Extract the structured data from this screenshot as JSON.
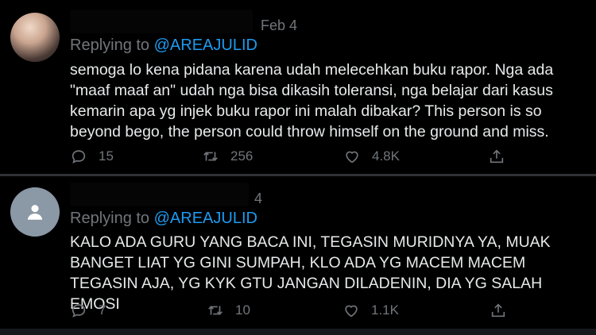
{
  "tweets": [
    {
      "date": "Feb 4",
      "replying_to_prefix": "Replying to ",
      "replying_to_handle": "@AREAJULID",
      "text": "semoga lo kena pidana karena udah melecehkan buku rapor. Nga ada \"maaf maaf an\" udah nga bisa dikasih toleransi, nga belajar dari kasus kemarin apa yg injek buku rapor ini malah dibakar? This person is so beyond bego, the person could throw himself on the ground and miss.",
      "replies": "15",
      "retweets": "256",
      "likes": "4.8K"
    },
    {
      "date": "4",
      "replying_to_prefix": "Replying to ",
      "replying_to_handle": "@AREAJULID",
      "text": "KALO ADA GURU YANG BACA INI, TEGASIN MURIDNYA YA, MUAK BANGET LIAT YG GINI SUMPAH, KLO ADA YG MACEM MACEM TEGASIN AJA, YG KYK GTU JANGAN DILADENIN, DIA YG SALAH EMOSI",
      "replies": "7",
      "retweets": "10",
      "likes": "1.1K"
    }
  ],
  "icons": {
    "reply": "reply-icon",
    "retweet": "retweet-icon",
    "like": "heart-icon",
    "share": "share-icon",
    "default_avatar": "person-icon"
  },
  "colors": {
    "background": "#000000",
    "text": "#e7e9ea",
    "muted": "#71767b",
    "link": "#1d9bf0"
  }
}
